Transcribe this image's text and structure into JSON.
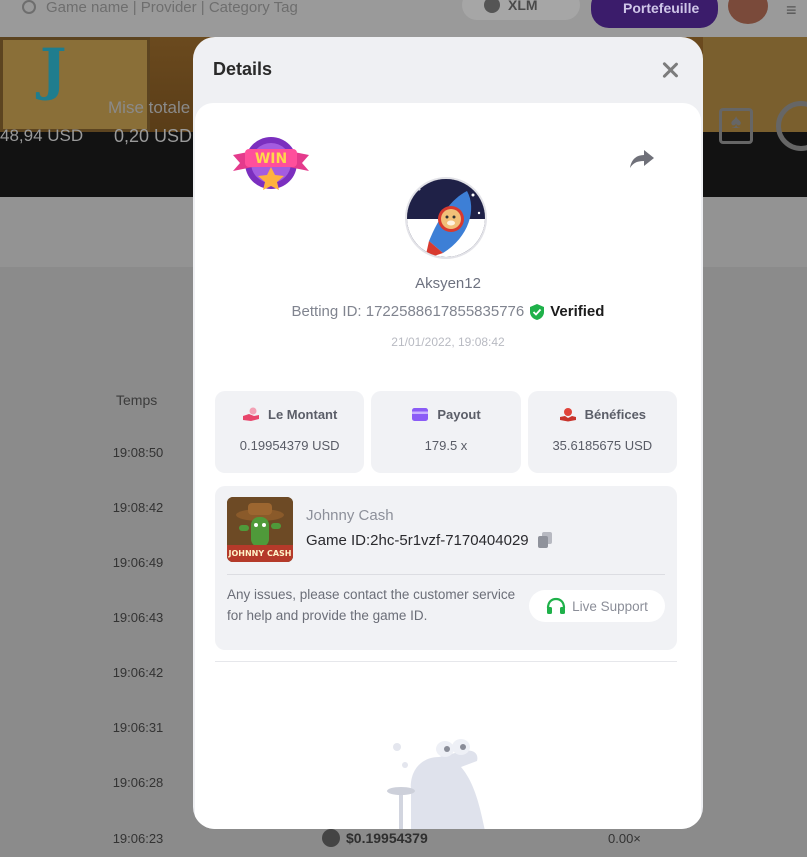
{
  "background": {
    "search_placeholder": "Game name | Provider | Category Tag",
    "currency": "XLM",
    "wallet_label": "Portefeuille",
    "balance": "48,94 USD",
    "mise_label": "Mise totale",
    "mise_value": "0,20 USD",
    "column_header": "Temps",
    "times": [
      "19:08:50",
      "19:08:42",
      "19:06:49",
      "19:06:43",
      "19:06:42",
      "19:06:31",
      "19:06:28",
      "19:06:23"
    ],
    "footer_amount": "$0.19954379",
    "footer_payout": "0.00×"
  },
  "modal": {
    "title": "Details",
    "win_badge_text": "WIN",
    "username": "Aksyen12",
    "betting_label": "Betting ID: 1722588617855835776",
    "verified_label": "Verified",
    "bet_time": "21/01/2022, 19:08:42",
    "stats": [
      {
        "label": "Le Montant",
        "value": "0.19954379 USD",
        "icon": "hand-coin-icon",
        "color": "#e8456b"
      },
      {
        "label": "Payout",
        "value": "179.5 x",
        "icon": "card-icon",
        "color": "#8b5cf6"
      },
      {
        "label": "Bénéfices",
        "value": "35.6185675 USD",
        "icon": "hand-profit-icon",
        "color": "#e0443a"
      }
    ],
    "game": {
      "thumb_label": "JOHNNY CASH",
      "name": "Johnny Cash",
      "id_label": "Game ID:2hc-5r1vzf-7170404029"
    },
    "help_text": "Any issues, please contact the customer service for help and provide the game ID.",
    "support_label": "Live Support",
    "accent_green": "#1fb14a"
  }
}
